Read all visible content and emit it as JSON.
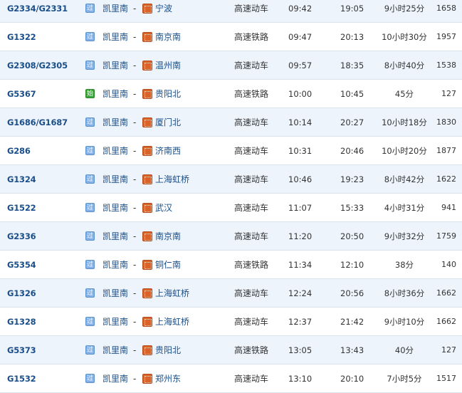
{
  "station_from": "凯里南",
  "separator": "-",
  "badges": {
    "pass": "过",
    "start": "始"
  },
  "rows": [
    {
      "train_no": "G2334/G2331",
      "badge": "pass",
      "to": "宁波",
      "type": "高速动车",
      "dep": "09:42",
      "arr": "19:05",
      "duration": "9小时25分",
      "distance": "1658"
    },
    {
      "train_no": "G1322",
      "badge": "pass",
      "to": "南京南",
      "type": "高速铁路",
      "dep": "09:47",
      "arr": "20:13",
      "duration": "10小时30分",
      "distance": "1957"
    },
    {
      "train_no": "G2308/G2305",
      "badge": "pass",
      "to": "温州南",
      "type": "高速动车",
      "dep": "09:57",
      "arr": "18:35",
      "duration": "8小时40分",
      "distance": "1538"
    },
    {
      "train_no": "G5367",
      "badge": "start",
      "to": "贵阳北",
      "type": "高速铁路",
      "dep": "10:00",
      "arr": "10:45",
      "duration": "45分",
      "distance": "127"
    },
    {
      "train_no": "G1686/G1687",
      "badge": "pass",
      "to": "厦门北",
      "type": "高速动车",
      "dep": "10:14",
      "arr": "20:27",
      "duration": "10小时18分",
      "distance": "1830"
    },
    {
      "train_no": "G286",
      "badge": "pass",
      "to": "济南西",
      "type": "高速动车",
      "dep": "10:31",
      "arr": "20:46",
      "duration": "10小时20分",
      "distance": "1877"
    },
    {
      "train_no": "G1324",
      "badge": "pass",
      "to": "上海虹桥",
      "type": "高速动车",
      "dep": "10:46",
      "arr": "19:23",
      "duration": "8小时42分",
      "distance": "1622"
    },
    {
      "train_no": "G1522",
      "badge": "pass",
      "to": "武汉",
      "type": "高速动车",
      "dep": "11:07",
      "arr": "15:33",
      "duration": "4小时31分",
      "distance": "941"
    },
    {
      "train_no": "G2336",
      "badge": "pass",
      "to": "南京南",
      "type": "高速动车",
      "dep": "11:20",
      "arr": "20:50",
      "duration": "9小时32分",
      "distance": "1759"
    },
    {
      "train_no": "G5354",
      "badge": "pass",
      "to": "铜仁南",
      "type": "高速铁路",
      "dep": "11:34",
      "arr": "12:10",
      "duration": "38分",
      "distance": "140"
    },
    {
      "train_no": "G1326",
      "badge": "pass",
      "to": "上海虹桥",
      "type": "高速动车",
      "dep": "12:24",
      "arr": "20:56",
      "duration": "8小时36分",
      "distance": "1662"
    },
    {
      "train_no": "G1328",
      "badge": "pass",
      "to": "上海虹桥",
      "type": "高速动车",
      "dep": "12:37",
      "arr": "21:42",
      "duration": "9小时10分",
      "distance": "1662"
    },
    {
      "train_no": "G5373",
      "badge": "pass",
      "to": "贵阳北",
      "type": "高速铁路",
      "dep": "13:05",
      "arr": "13:43",
      "duration": "40分",
      "distance": "127"
    },
    {
      "train_no": "G1532",
      "badge": "pass",
      "to": "郑州东",
      "type": "高速动车",
      "dep": "13:10",
      "arr": "20:10",
      "duration": "7小时5分",
      "distance": "1517"
    }
  ]
}
